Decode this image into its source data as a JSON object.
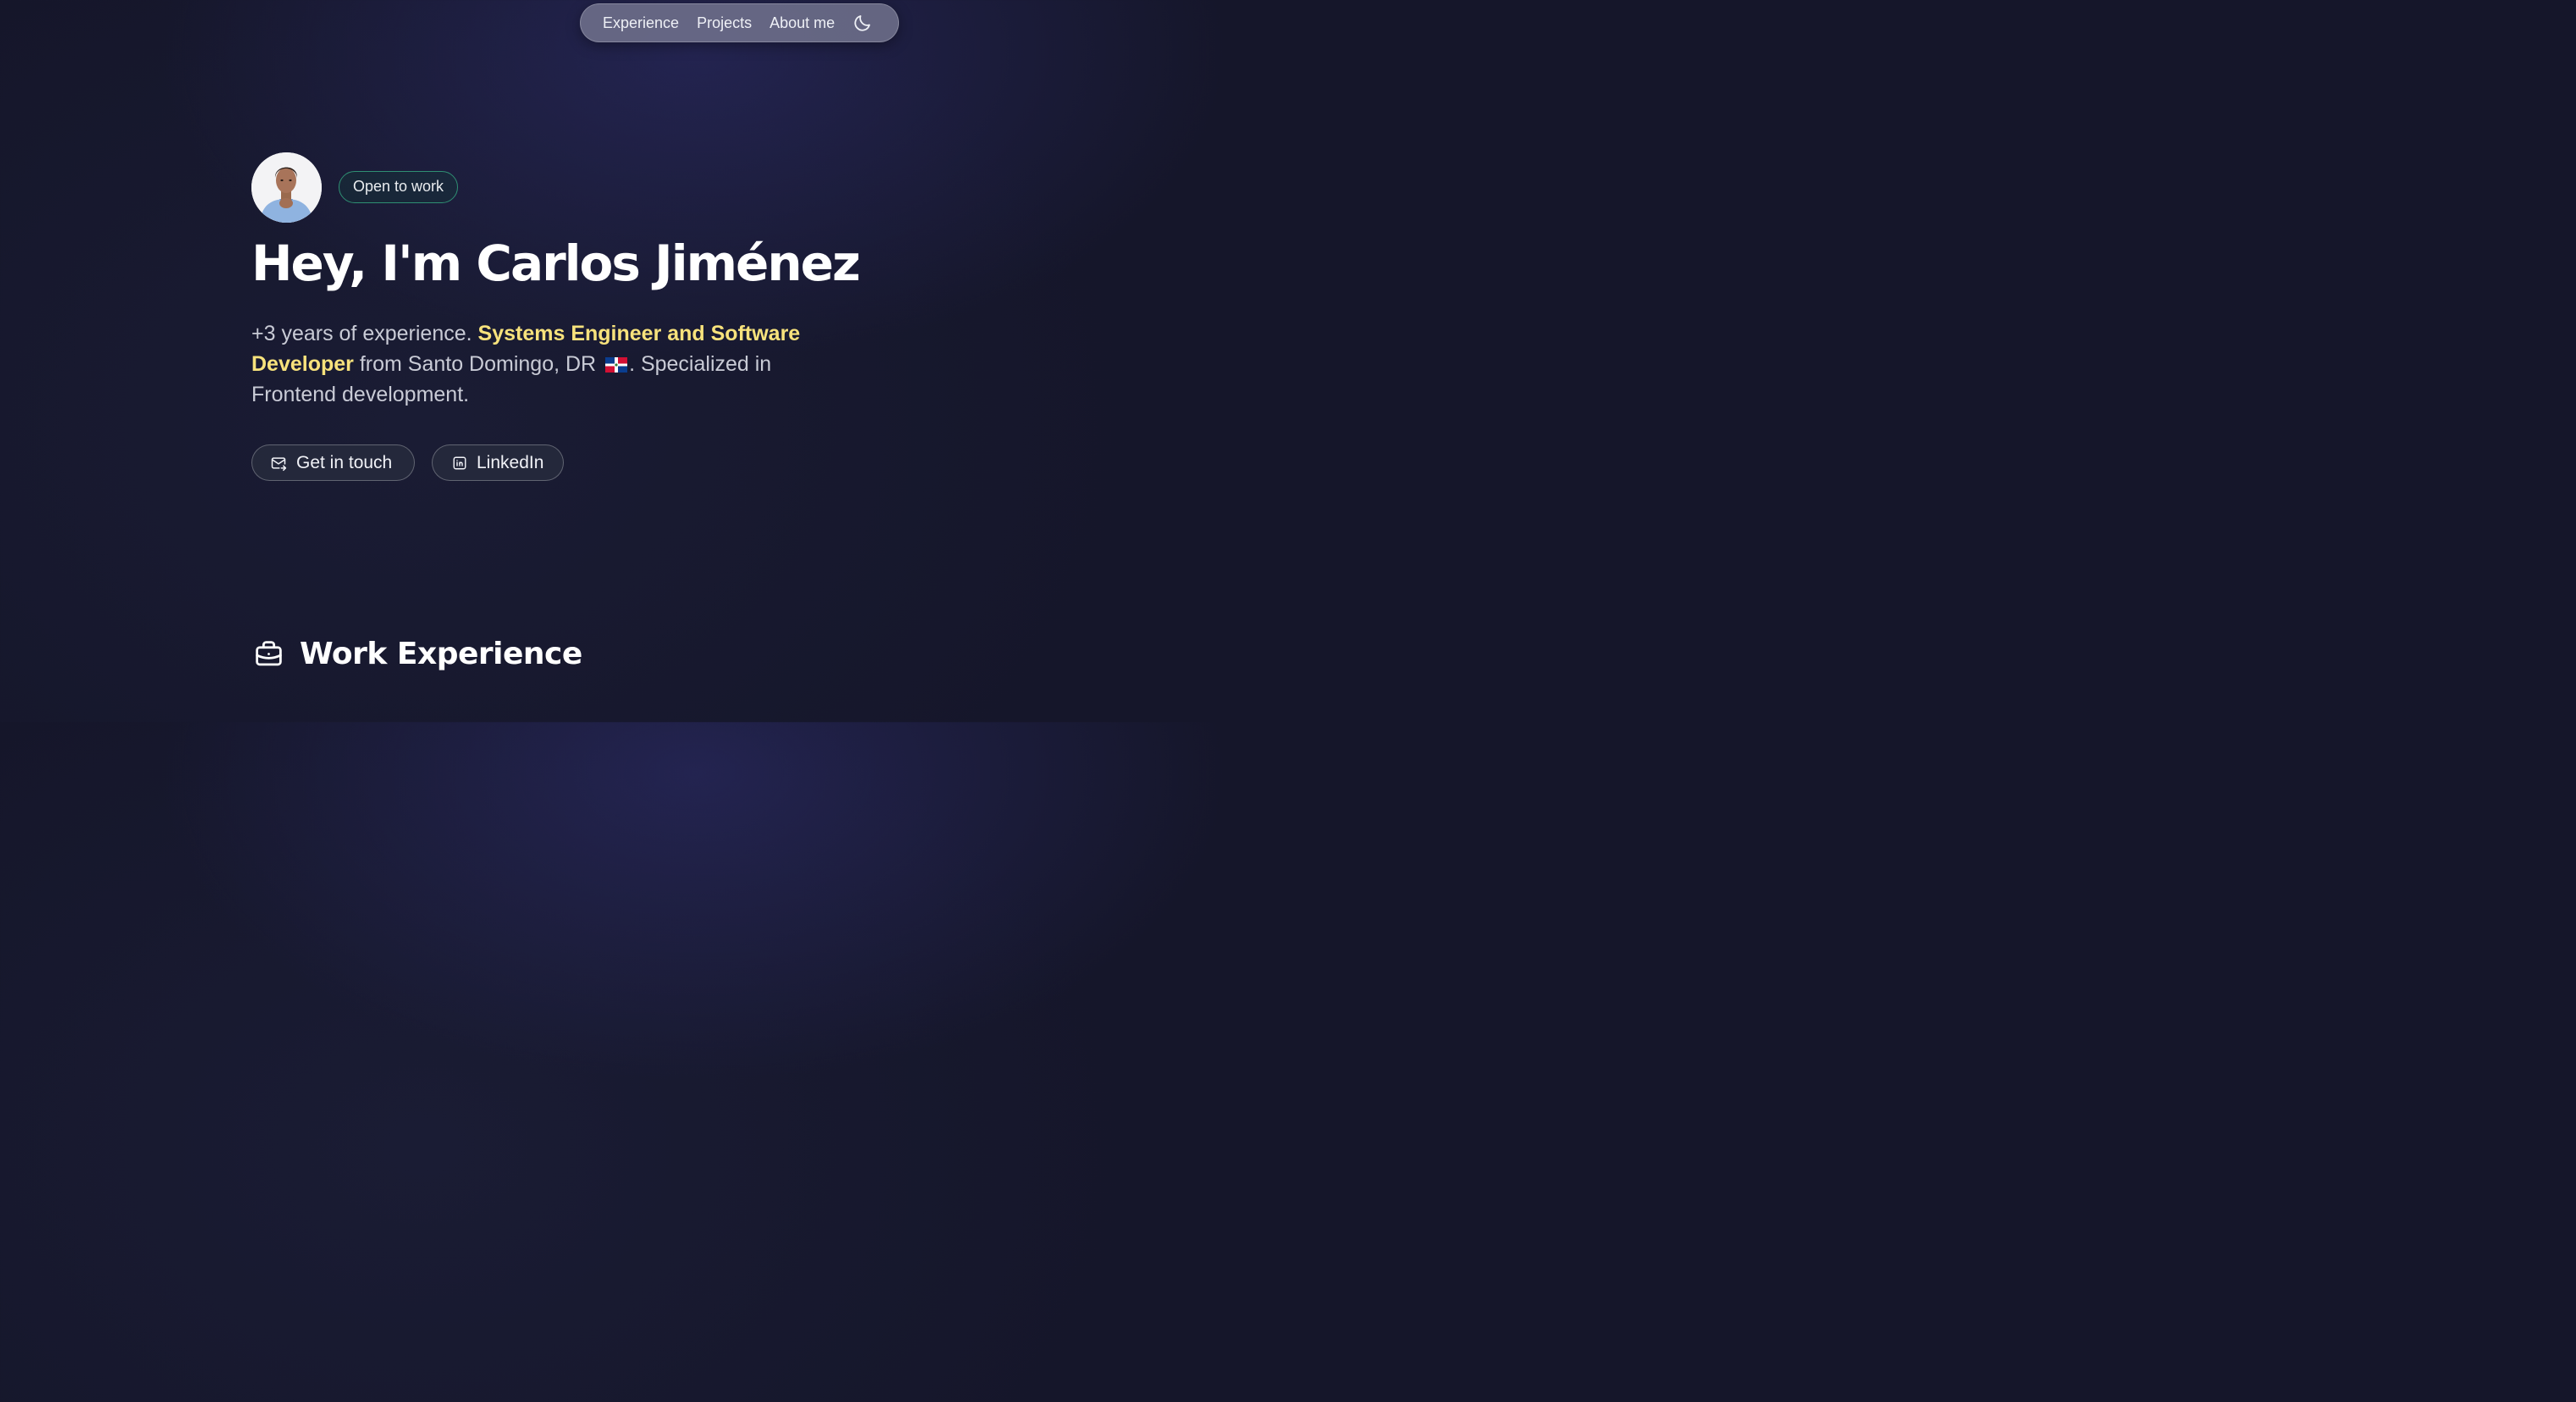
{
  "nav": {
    "links": [
      "Experience",
      "Projects",
      "About me"
    ],
    "theme_toggle_icon": "moon-icon"
  },
  "hero": {
    "avatar_icon": "profile-photo",
    "badge": "Open to work",
    "title": "Hey, I'm Carlos Jiménez",
    "intro": {
      "part1": "+3 years of experience. ",
      "highlight": "Systems Engineer and Software Developer",
      "part2": " from Santo Domingo, DR ",
      "flag_icon": "dominican-republic-flag-icon",
      "part3": ". Specialized in Frontend development."
    },
    "buttons": {
      "contact": "Get in touch",
      "linkedin": "LinkedIn"
    }
  },
  "section": {
    "title": "Work Experience",
    "icon": "briefcase-icon"
  },
  "colors": {
    "background": "#15162a",
    "highlight": "#f7e27c",
    "badge_border": "#2f8f73",
    "nav_bg": "#787a94"
  }
}
